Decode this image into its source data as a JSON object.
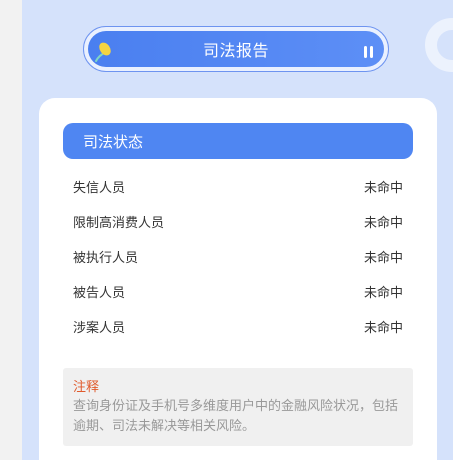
{
  "header": {
    "title": "司法报告"
  },
  "section": {
    "title": "司法状态"
  },
  "rows": [
    {
      "label": "失信人员",
      "status": "未命中"
    },
    {
      "label": "限制高消费人员",
      "status": "未命中"
    },
    {
      "label": "被执行人员",
      "status": "未命中"
    },
    {
      "label": "被告人员",
      "status": "未命中"
    },
    {
      "label": "涉案人员",
      "status": "未命中"
    }
  ],
  "note": {
    "title": "注释",
    "text": "查询身份证及手机号多维度用户中的金融风险状况，包括逾期、司法未解决等相关风险。"
  },
  "colors": {
    "accent": "#4f86f2",
    "note_title": "#e05a2c",
    "background": "#d5e2fb"
  }
}
